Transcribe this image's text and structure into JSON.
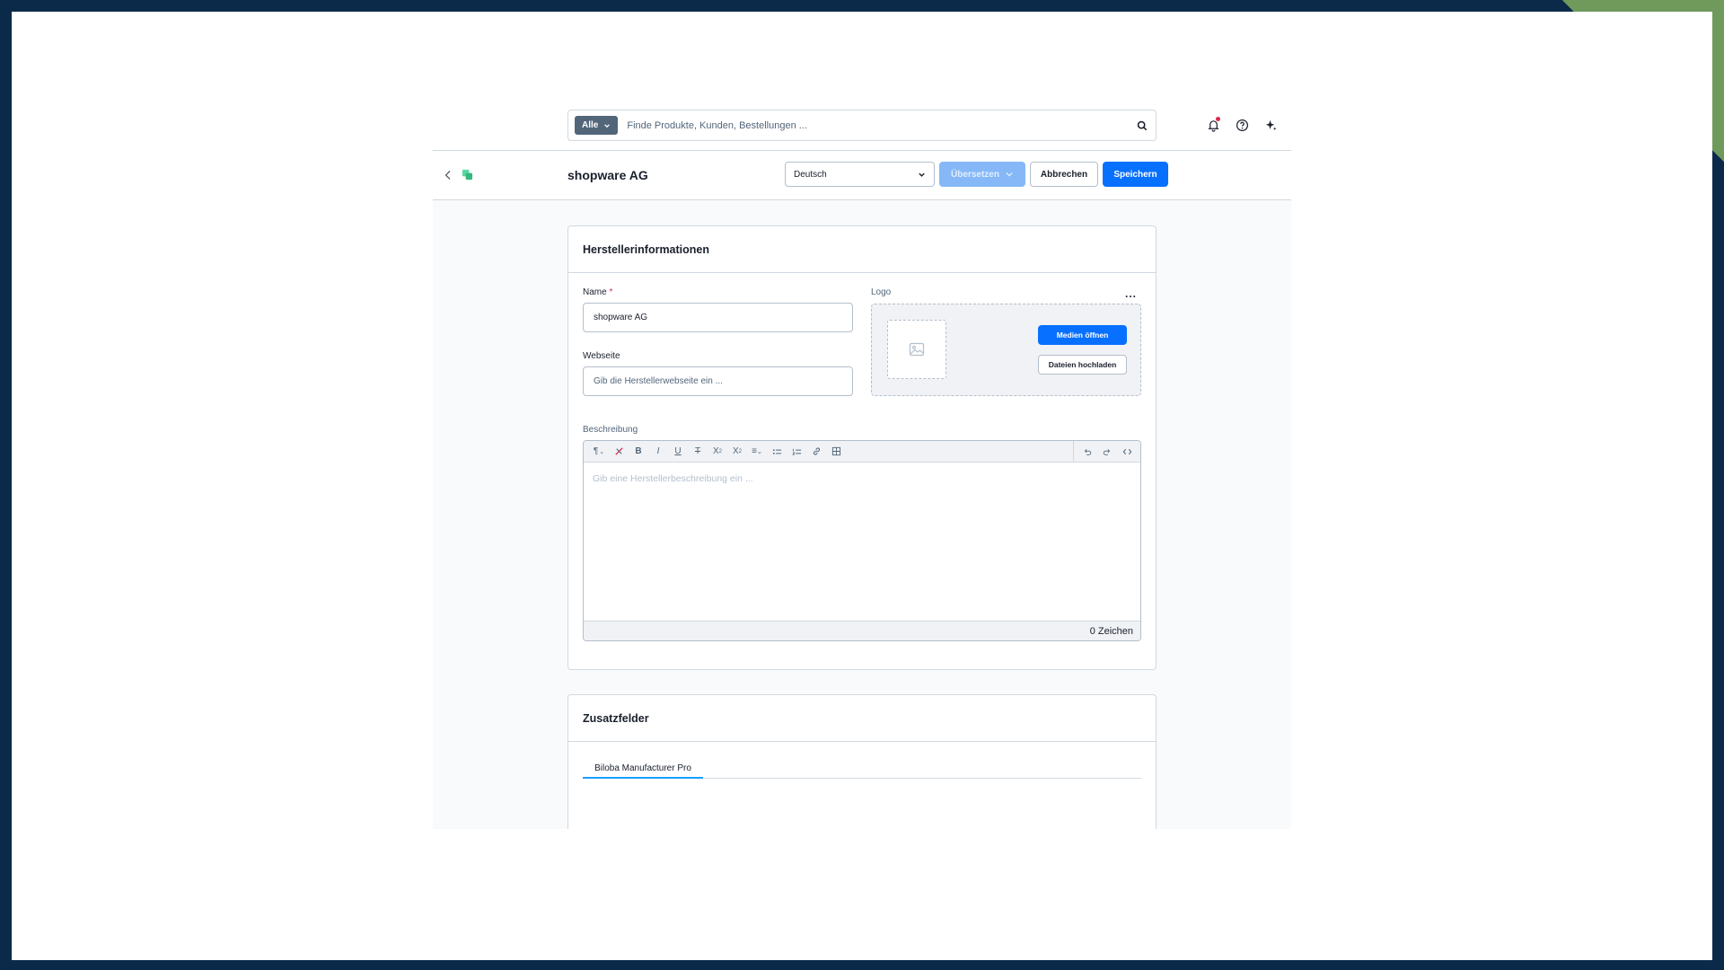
{
  "search": {
    "type_label": "Alle",
    "placeholder": "Finde Produkte, Kunden, Bestellungen ..."
  },
  "smartbar": {
    "title": "shopware AG",
    "language": "Deutsch",
    "translate_label": "Übersetzen",
    "cancel_label": "Abbrechen",
    "save_label": "Speichern"
  },
  "manufacturer_card": {
    "title": "Herstellerinformationen",
    "name_label": "Name",
    "required_mark": "*",
    "name_value": "shopware AG",
    "website_label": "Webseite",
    "website_placeholder": "Gib die Herstellerwebseite ein ...",
    "logo_label": "Logo",
    "logo_menu": "...",
    "open_media_label": "Medien öffnen",
    "upload_label": "Dateien hochladen",
    "description_label": "Beschreibung",
    "description_placeholder": "Gib eine Herstellerbeschreibung ein ...",
    "char_count": "0 Zeichen"
  },
  "custom_fields_card": {
    "title": "Zusatzfelder",
    "tabs": [
      {
        "label": "Biloba Manufacturer Pro",
        "active": true
      }
    ]
  },
  "colors": {
    "primary": "#0870ff",
    "primary_disabled": "#86b8f7",
    "border": "#d1d9e0",
    "text": "#1a202c",
    "muted": "#52667a",
    "required": "#de294c",
    "tab_active": "#189eff"
  }
}
